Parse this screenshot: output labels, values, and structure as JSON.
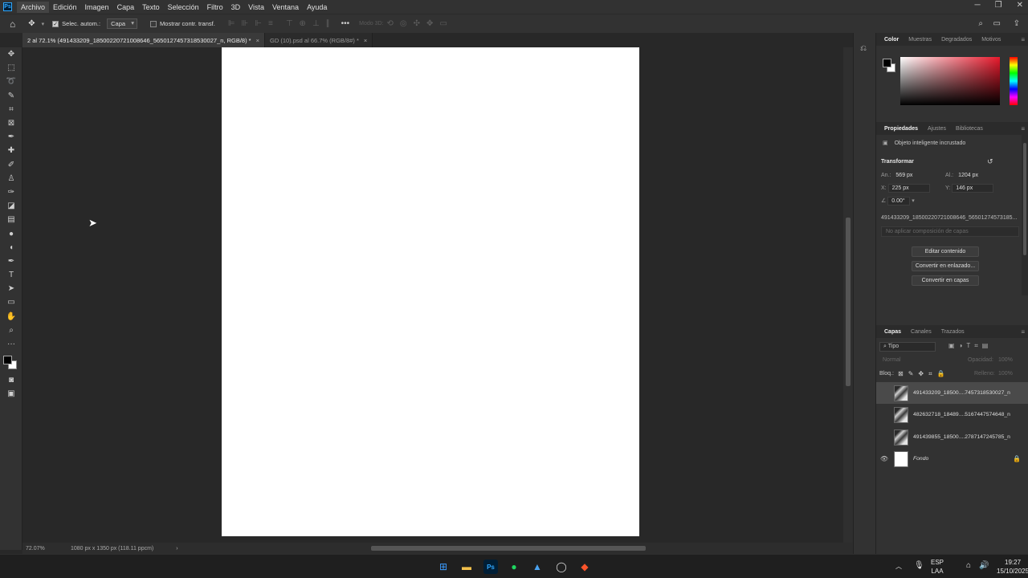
{
  "app": {
    "logo": "Ps",
    "menu": [
      "Archivo",
      "Edición",
      "Imagen",
      "Capa",
      "Texto",
      "Selección",
      "Filtro",
      "3D",
      "Vista",
      "Ventana",
      "Ayuda"
    ]
  },
  "options": {
    "auto_select_label": "Selec. autom.:",
    "auto_select_value": "Capa",
    "show_transform_label": "Mostrar contr. transf.",
    "mode_3d_label": "Modo 3D:"
  },
  "tabs": [
    {
      "label": "2 al 72.1% (491433209_18500220721008646_5650127457318530027_n, RGB/8) *",
      "close": "×"
    },
    {
      "label": "GD (10).psd al 66.7% (RGB/8#) *",
      "close": "×"
    }
  ],
  "status": {
    "zoom": "72.07%",
    "doc_info": "1080 px x 1350 px (118.11 ppcm)",
    "arrow": "›"
  },
  "color_panel": {
    "tabs": [
      "Color",
      "Muestras",
      "Degradados",
      "Motivos"
    ]
  },
  "properties": {
    "tabs": [
      "Propiedades",
      "Ajustes",
      "Bibliotecas"
    ],
    "object_type": "Objeto inteligente incrustado",
    "transform_title": "Transformar",
    "w_label": "An.:",
    "w_value": "569 px",
    "h_label": "Al.:",
    "h_value": "1204 px",
    "x_label": "X:",
    "x_value": "225 px",
    "y_label": "Y:",
    "y_value": "146 px",
    "angle_value": "0.00°",
    "filename": "491433209_18500220721008646_56501274573185...",
    "comp_placeholder": "No aplicar composición de capas",
    "buttons": [
      "Editar contenido",
      "Convertir en enlazado...",
      "Convertir en capas"
    ]
  },
  "layers_panel": {
    "tabs": [
      "Capas",
      "Canales",
      "Trazados"
    ],
    "filter_label": "Tipo",
    "blend_mode": "Normal",
    "opacity_label": "Opacidad:",
    "opacity_value": "100%",
    "lock_label": "Bloq.:",
    "fill_label": "Relleno:",
    "fill_value": "100%",
    "layers": [
      {
        "name": "491433209_18500....7457318530027_n",
        "visible": false,
        "selected": true
      },
      {
        "name": "482632718_18489....5167447574648_n",
        "visible": false,
        "selected": false
      },
      {
        "name": "491439855_18500....2787147245785_n",
        "visible": false,
        "selected": false
      },
      {
        "name": "Fondo",
        "visible": true,
        "selected": false,
        "locked": true
      }
    ]
  },
  "taskbar": {
    "lang_top": "ESP",
    "lang_bottom": "LAA",
    "time": "19:27",
    "date": "15/10/2025"
  }
}
